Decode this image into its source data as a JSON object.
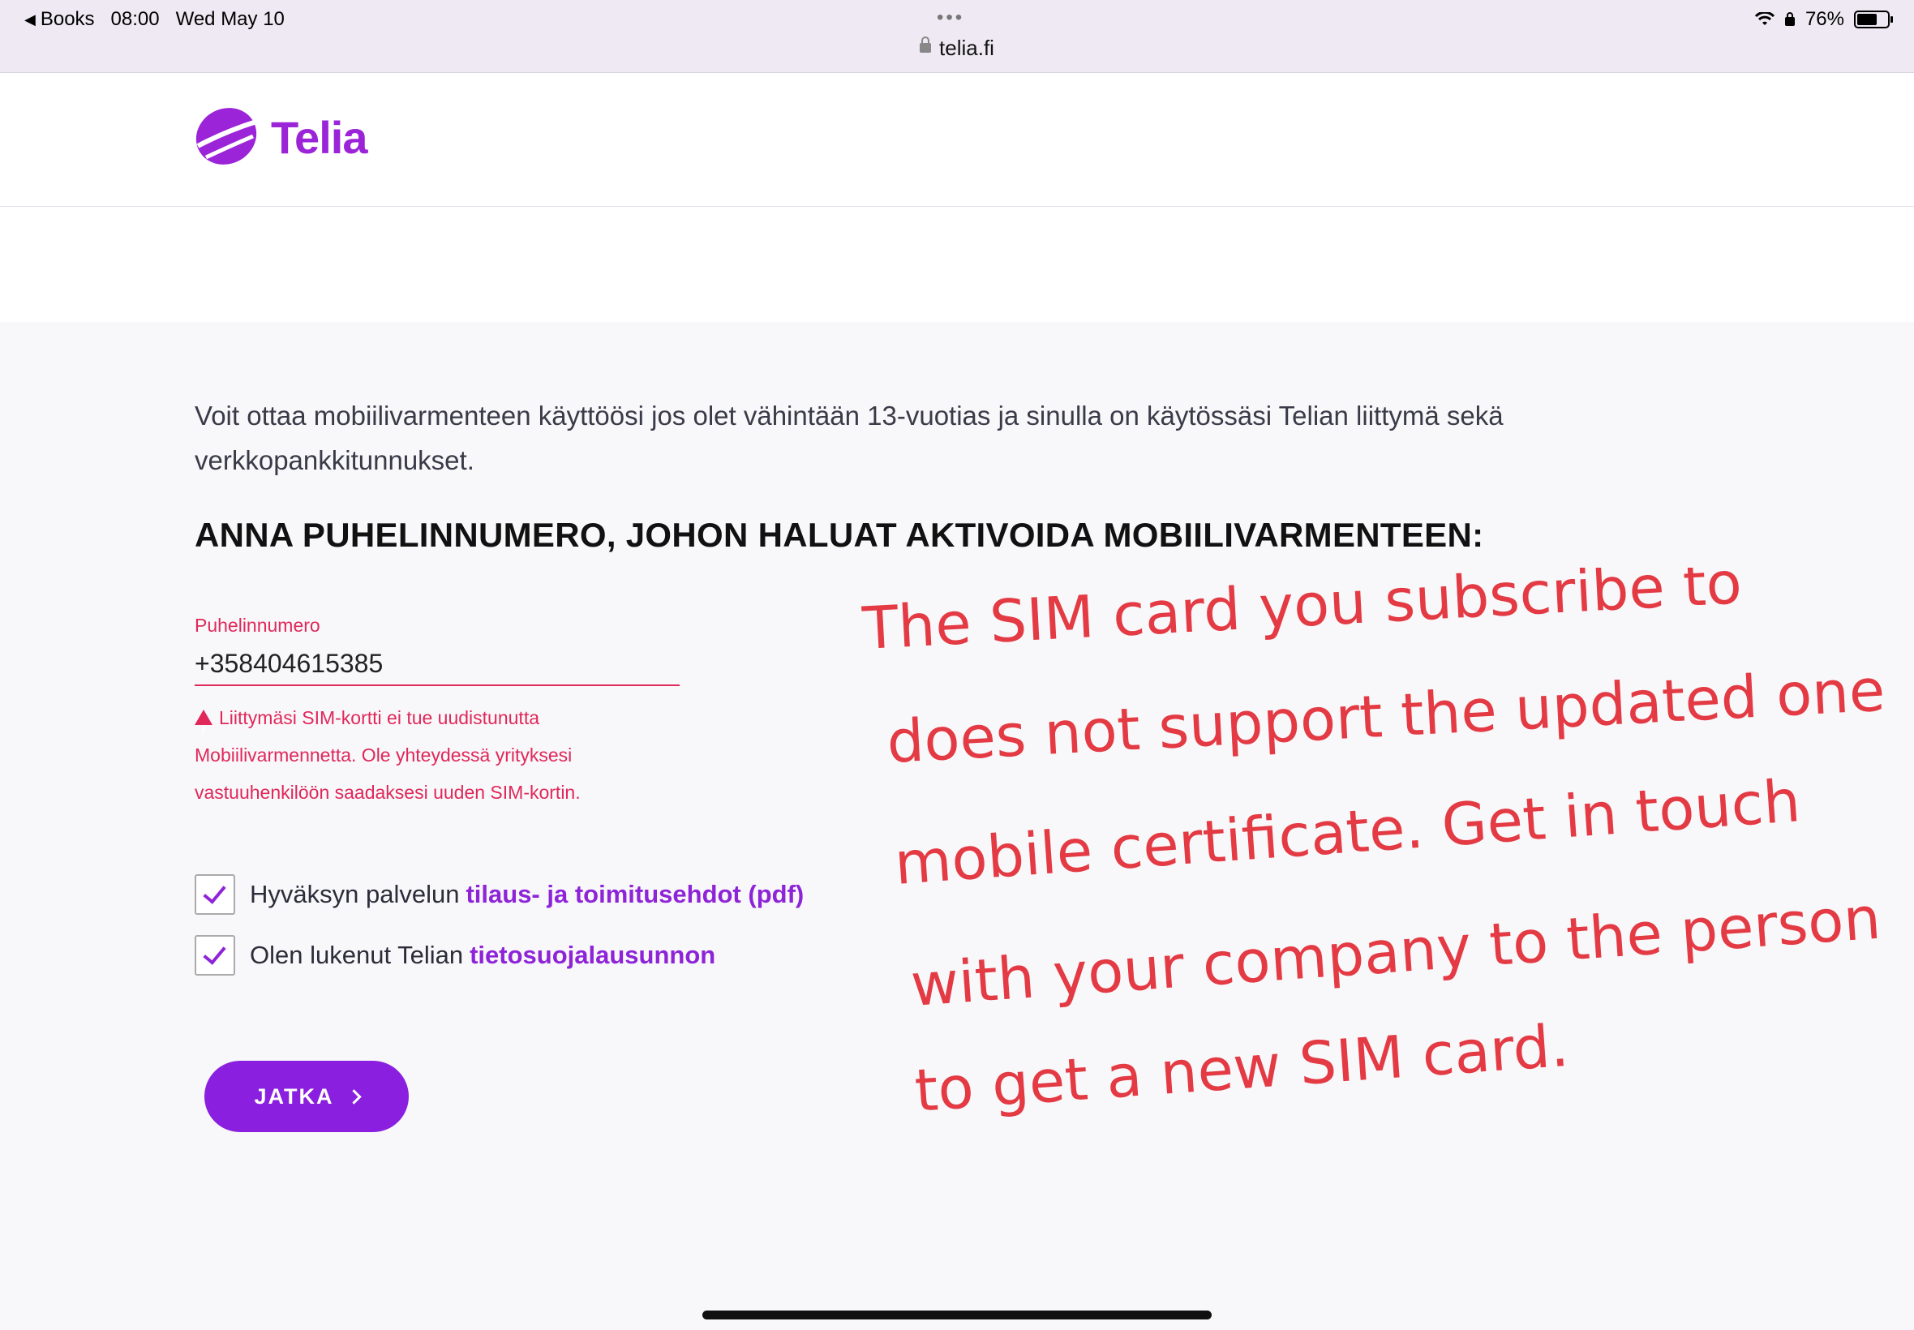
{
  "status_bar": {
    "back_label": "Books",
    "time": "08:00",
    "date": "Wed May 10",
    "battery": "76%",
    "battery_level": 0.76,
    "url": "telia.fi"
  },
  "header": {
    "logo_text": "Telia"
  },
  "intro_text": "Voit ottaa mobiilivarmenteen käyttöösi jos olet vähintään 13-vuotias ja sinulla on käytössäsi Telian liittymä sekä verkkopankkitunnukset.",
  "heading": "ANNA PUHELINNUMERO, JOHON HALUAT AKTIVOIDA MOBIILIVARMENTEEN:",
  "phone_field": {
    "label": "Puhelinnumero",
    "value": "+358404615385",
    "error": "Liittymäsi SIM-kortti ei tue uudistunutta Mobiilivarmennetta. Ole yhteydessä yrityksesi vastuuhenkilöön saadaksesi uuden SIM-kortin."
  },
  "checkboxes": [
    {
      "text": "Hyväksyn palvelun",
      "link": "tilaus- ja toimitusehdot (pdf)",
      "checked": true
    },
    {
      "text": "Olen lukenut Telian",
      "link": "tietosuojalausunnon",
      "checked": true
    }
  ],
  "continue_button": "JATKA",
  "handwritten_note": [
    "The SIM card you subscribe to",
    "does not support the updated one",
    "mobile certificate. Get in touch",
    "with your company to the person",
    "to get a new SIM card."
  ],
  "colors": {
    "brand_purple": "#8a1fdf",
    "error_red": "#e0285a",
    "annotation_red": "#e33a44"
  }
}
